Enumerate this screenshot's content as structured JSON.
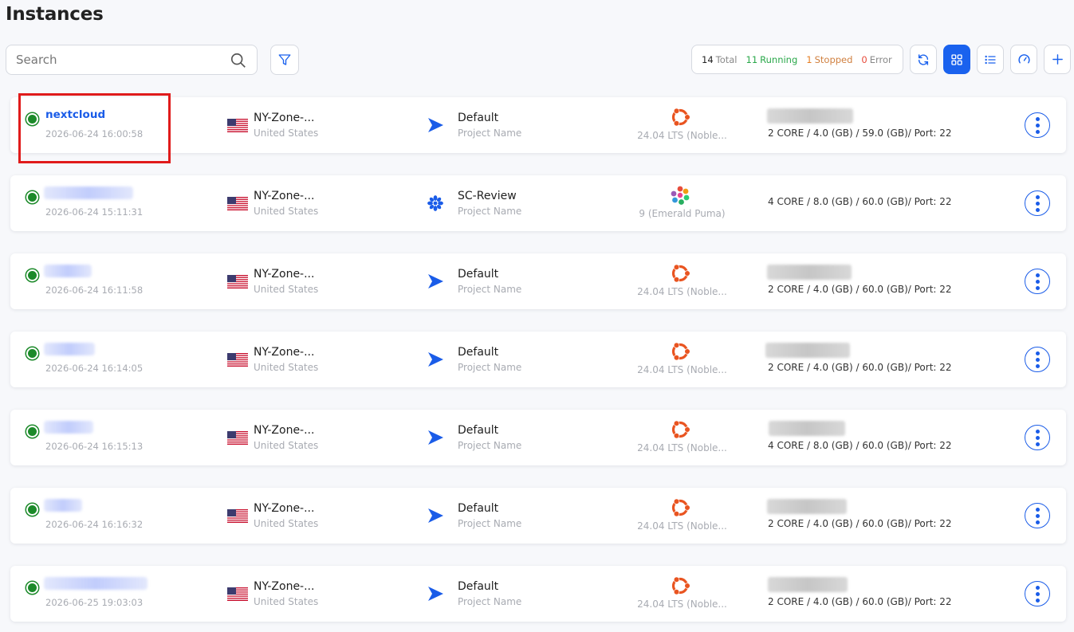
{
  "page": {
    "title": "Instances"
  },
  "search": {
    "placeholder": "Search"
  },
  "stats": {
    "total_count": "14",
    "total_label": "Total",
    "running_count": "11",
    "running_label": "Running",
    "stopped_count": "1",
    "stopped_label": "Stopped",
    "error_count": "0",
    "error_label": "Error"
  },
  "toolbar": {
    "icons": [
      "filter-icon",
      "refresh-icon",
      "grid-view-icon",
      "list-view-icon",
      "gauge-icon",
      "plus-icon"
    ],
    "accent": "#1a62ee"
  },
  "colors": {
    "running": "#1c8a2a",
    "link": "#1a5ce8",
    "highlight": "#e01b1b"
  },
  "instances": [
    {
      "name": "nextcloud",
      "date": "2026-06-24 16:00:58",
      "zone": "NY-Zone-...",
      "country": "United States",
      "project": "Default",
      "project_sub": "Project Name",
      "os_icon": "ubuntu-icon",
      "os": "24.04 LTS (Noble...",
      "spec": "2 CORE / 4.0 (GB) / 59.0 (GB)/ Port: 22"
    },
    {
      "name": "",
      "date": "2026-06-24 15:11:31",
      "zone": "NY-Zone-...",
      "country": "United States",
      "project": "SC-Review",
      "project_sub": "Project Name",
      "os_icon": "fedora-icon",
      "os": "9 (Emerald Puma)",
      "spec": "4 CORE / 8.0 (GB) / 60.0 (GB)/ Port: 22"
    },
    {
      "name": "",
      "date": "2026-06-24 16:11:58",
      "zone": "NY-Zone-...",
      "country": "United States",
      "project": "Default",
      "project_sub": "Project Name",
      "os_icon": "ubuntu-icon",
      "os": "24.04 LTS (Noble...",
      "spec": "2 CORE / 4.0 (GB) / 60.0 (GB)/ Port: 22"
    },
    {
      "name": "",
      "date": "2026-06-24 16:14:05",
      "zone": "NY-Zone-...",
      "country": "United States",
      "project": "Default",
      "project_sub": "Project Name",
      "os_icon": "ubuntu-icon",
      "os": "24.04 LTS (Noble...",
      "spec": "2 CORE / 4.0 (GB) / 60.0 (GB)/ Port: 22"
    },
    {
      "name": "",
      "date": "2026-06-24 16:15:13",
      "zone": "NY-Zone-...",
      "country": "United States",
      "project": "Default",
      "project_sub": "Project Name",
      "os_icon": "ubuntu-icon",
      "os": "24.04 LTS (Noble...",
      "spec": "4 CORE / 8.0 (GB) / 60.0 (GB)/ Port: 22"
    },
    {
      "name": "",
      "date": "2026-06-24 16:16:32",
      "zone": "NY-Zone-...",
      "country": "United States",
      "project": "Default",
      "project_sub": "Project Name",
      "os_icon": "ubuntu-icon",
      "os": "24.04 LTS (Noble...",
      "spec": "2 CORE / 4.0 (GB) / 60.0 (GB)/ Port: 22"
    },
    {
      "name": "",
      "date": "2026-06-25 19:03:03",
      "zone": "NY-Zone-...",
      "country": "United States",
      "project": "Default",
      "project_sub": "Project Name",
      "os_icon": "ubuntu-icon",
      "os": "24.04 LTS (Noble...",
      "spec": "2 CORE / 4.0 (GB) / 60.0 (GB)/ Port: 22"
    }
  ]
}
